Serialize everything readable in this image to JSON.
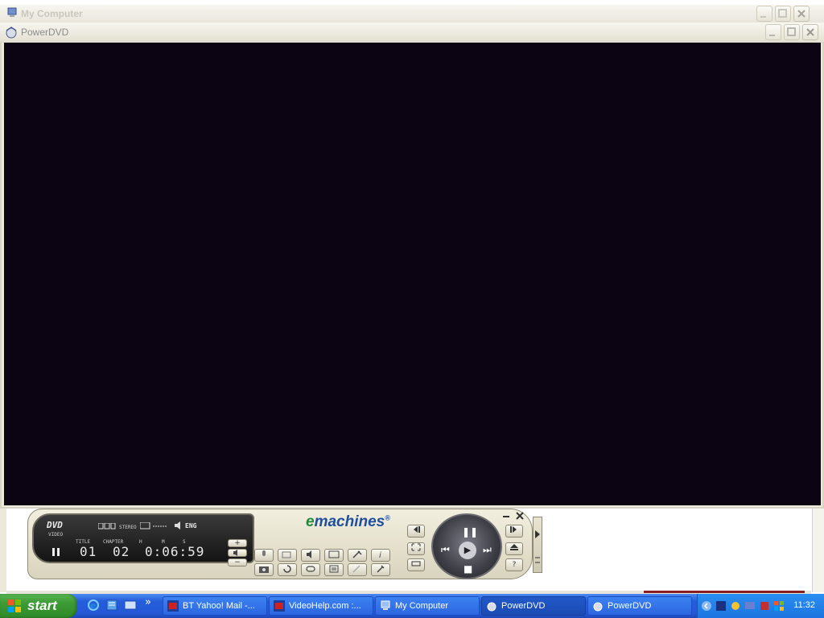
{
  "back_window": {
    "title": "My Computer"
  },
  "window": {
    "title": "PowerDVD"
  },
  "player": {
    "logo": "DVD",
    "logo_sub": "VIDEO",
    "audio_mode": "STEREO",
    "language": "ENG",
    "labels": {
      "title": "TITLE",
      "chapter": "CHAPTER",
      "h": "H",
      "m": "M",
      "s": "S"
    },
    "title_num": "01",
    "chapter_num": "02",
    "time": "0:06:59",
    "brand_e": "e",
    "brand_rest": "machines",
    "brand_reg": "®"
  },
  "taskbar": {
    "start_label": "start",
    "tasks": [
      {
        "label": "BT Yahoo! Mail -..."
      },
      {
        "label": "VideoHelp.com :..."
      },
      {
        "label": "My Computer"
      },
      {
        "label": "PowerDVD"
      },
      {
        "label": "PowerDVD"
      }
    ],
    "chevron": "»",
    "clock": "11:32"
  },
  "colors": {
    "video_bg": "#0c0412",
    "taskbar": "#245edb",
    "start": "#3c9a35",
    "brand": "#1f4f9c"
  }
}
